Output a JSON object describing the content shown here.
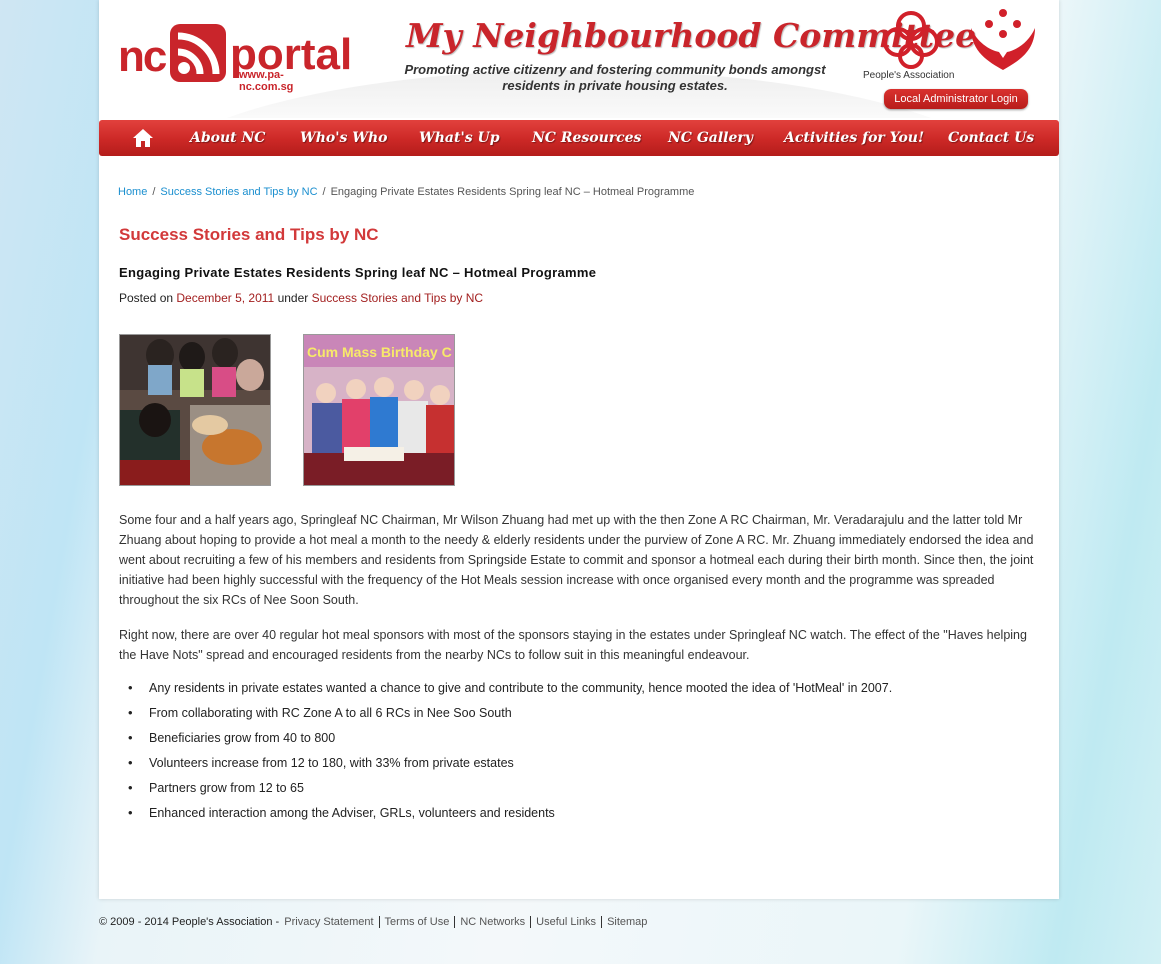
{
  "header": {
    "logo_nc": "nc",
    "logo_portal": "portal",
    "logo_url": "www.pa-nc.com.sg",
    "title": "My Neighbourhood Committee",
    "subtitle": "Promoting active citizenry and fostering community bonds amongst residents in private housing estates.",
    "pa_label": "People's Association",
    "admin_login": "Local Administrator Login"
  },
  "nav": {
    "items": [
      "About NC",
      "Who's Who",
      "What's Up",
      "NC Resources",
      "NC Gallery",
      "Activities for You!",
      "Contact Us"
    ]
  },
  "breadcrumb": {
    "home": "Home",
    "section": "Success Stories and Tips by NC",
    "current": "Engaging Private Estates Residents Spring leaf NC – Hotmeal Programme"
  },
  "content": {
    "section_title": "Success Stories and Tips by NC",
    "post_title": "Engaging Private Estates Residents Spring leaf NC – Hotmeal Programme",
    "meta_posted": "Posted on",
    "meta_date": "December 5, 2011",
    "meta_under": "under",
    "meta_category": "Success Stories and Tips by NC",
    "photo2_banner": "Cum Mass Birthday C",
    "paragraph1": "Some four and a half years ago, Springleaf NC Chairman, Mr Wilson Zhuang had met up with the then Zone A RC Chairman, Mr. Veradarajulu and the latter told Mr Zhuang about hoping to provide a hot meal a month to the needy & elderly residents under the purview of Zone A RC. Mr. Zhuang immediately endorsed the idea and went about recruiting a few of his members and residents from Springside Estate to commit and sponsor a hotmeal each during their birth month. Since then, the joint initiative had been highly successful with the frequency of the Hot Meals session increase with once organised every month and the programme was spreaded throughout the six RCs of Nee Soon South.",
    "paragraph2": "Right now, there are over 40 regular hot meal sponsors with most of the sponsors staying in the estates under Springleaf NC watch. The effect of the \"Haves helping the Have Nots\" spread and encouraged residents from the nearby NCs to follow suit in this meaningful endeavour.",
    "bullets": [
      "Any residents in private estates wanted a chance to give and contribute to the community, hence mooted the idea of 'HotMeal' in 2007.",
      "From collaborating with RC Zone A to all 6 RCs in Nee Soo South",
      "Beneficiaries grow from 40 to 800",
      "Volunteers increase from 12 to 180, with 33% from private estates",
      "Partners grow from 12 to 65",
      "Enhanced interaction among the Adviser, GRLs, volunteers and residents"
    ]
  },
  "footer": {
    "copyright": "© 2009 - 2014 People's Association -",
    "links": [
      "Privacy Statement",
      "Terms of Use",
      "NC Networks",
      "Useful Links",
      "Sitemap"
    ]
  },
  "colors": {
    "brand_red": "#c9252b",
    "link_blue": "#1b8fcf",
    "section_title": "#d2393a"
  }
}
